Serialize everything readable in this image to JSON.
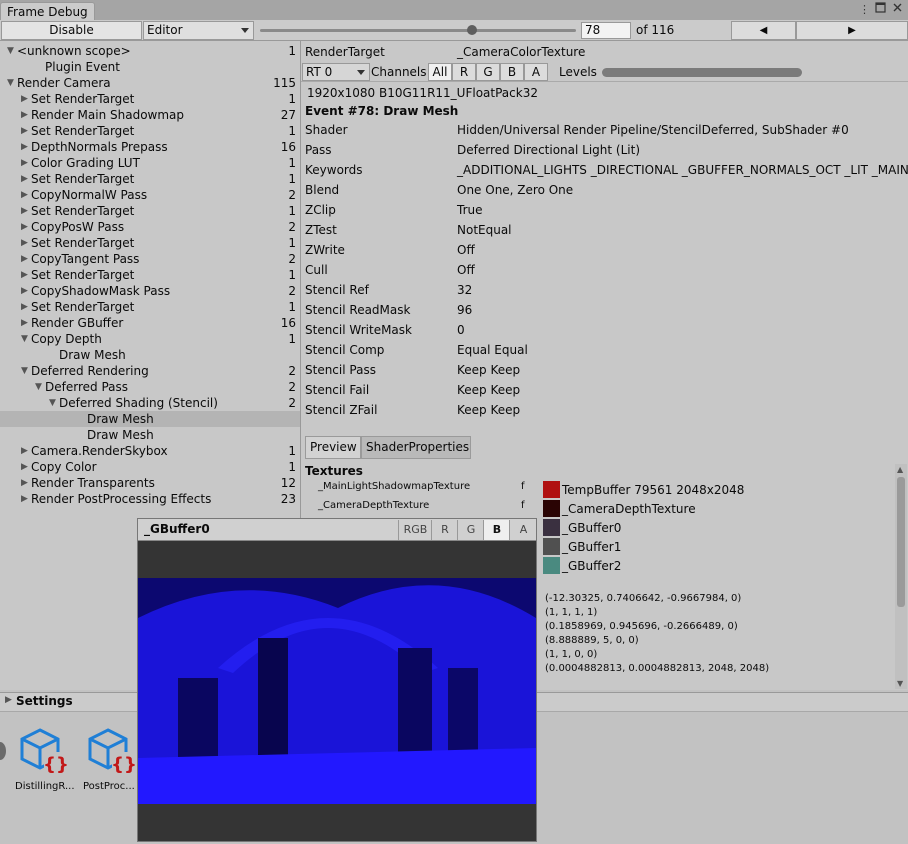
{
  "window": {
    "tab_title": "Frame Debug",
    "menu_icon": "kebab-menu-icon",
    "maximize_icon": "maximize-icon",
    "close_icon": "close-icon"
  },
  "toolbar": {
    "disable_label": "Disable",
    "target_select": "Editor",
    "frame_value": "78",
    "frame_of": "of 116",
    "prev_glyph": "◀",
    "next_glyph": "▶",
    "slider_fraction": 0.67
  },
  "tree": [
    {
      "label": "<unknown scope>",
      "count": "1",
      "indent": 0,
      "arrow": "▼"
    },
    {
      "label": "Plugin Event",
      "count": "",
      "indent": 2,
      "arrow": ""
    },
    {
      "label": "Render Camera",
      "count": "115",
      "indent": 0,
      "arrow": "▼"
    },
    {
      "label": "Set RenderTarget",
      "count": "1",
      "indent": 1,
      "arrow": "▶"
    },
    {
      "label": "Render Main Shadowmap",
      "count": "27",
      "indent": 1,
      "arrow": "▶"
    },
    {
      "label": "Set RenderTarget",
      "count": "1",
      "indent": 1,
      "arrow": "▶"
    },
    {
      "label": "DepthNormals Prepass",
      "count": "16",
      "indent": 1,
      "arrow": "▶"
    },
    {
      "label": "Color Grading LUT",
      "count": "1",
      "indent": 1,
      "arrow": "▶"
    },
    {
      "label": "Set RenderTarget",
      "count": "1",
      "indent": 1,
      "arrow": "▶"
    },
    {
      "label": "CopyNormalW Pass",
      "count": "2",
      "indent": 1,
      "arrow": "▶"
    },
    {
      "label": "Set RenderTarget",
      "count": "1",
      "indent": 1,
      "arrow": "▶"
    },
    {
      "label": "CopyPosW Pass",
      "count": "2",
      "indent": 1,
      "arrow": "▶"
    },
    {
      "label": "Set RenderTarget",
      "count": "1",
      "indent": 1,
      "arrow": "▶"
    },
    {
      "label": "CopyTangent Pass",
      "count": "2",
      "indent": 1,
      "arrow": "▶"
    },
    {
      "label": "Set RenderTarget",
      "count": "1",
      "indent": 1,
      "arrow": "▶"
    },
    {
      "label": "CopyShadowMask Pass",
      "count": "2",
      "indent": 1,
      "arrow": "▶"
    },
    {
      "label": "Set RenderTarget",
      "count": "1",
      "indent": 1,
      "arrow": "▶"
    },
    {
      "label": "Render GBuffer",
      "count": "16",
      "indent": 1,
      "arrow": "▶"
    },
    {
      "label": "Copy Depth",
      "count": "1",
      "indent": 1,
      "arrow": "▼"
    },
    {
      "label": "Draw Mesh",
      "count": "",
      "indent": 3,
      "arrow": ""
    },
    {
      "label": "Deferred Rendering",
      "count": "2",
      "indent": 1,
      "arrow": "▼"
    },
    {
      "label": "Deferred Pass",
      "count": "2",
      "indent": 2,
      "arrow": "▼"
    },
    {
      "label": "Deferred Shading (Stencil)",
      "count": "2",
      "indent": 3,
      "arrow": "▼"
    },
    {
      "label": "Draw Mesh",
      "count": "",
      "indent": 5,
      "arrow": "",
      "selected": true
    },
    {
      "label": "Draw Mesh",
      "count": "",
      "indent": 5,
      "arrow": ""
    },
    {
      "label": "Camera.RenderSkybox",
      "count": "1",
      "indent": 1,
      "arrow": "▶"
    },
    {
      "label": "Copy Color",
      "count": "1",
      "indent": 1,
      "arrow": "▶"
    },
    {
      "label": "Render Transparents",
      "count": "12",
      "indent": 1,
      "arrow": "▶"
    },
    {
      "label": "Render PostProcessing Effects",
      "count": "23",
      "indent": 1,
      "arrow": "▶"
    }
  ],
  "details": {
    "render_target_label": "RenderTarget",
    "render_target_value": "_CameraColorTexture",
    "rt_select": "RT 0",
    "channels_label": "Channels",
    "channels": [
      "All",
      "R",
      "G",
      "B",
      "A"
    ],
    "channels_active": "All",
    "levels_label": "Levels",
    "format": "1920x1080 B10G11R11_UFloatPack32",
    "event_title": "Event #78: Draw Mesh",
    "props": [
      {
        "k": "Shader",
        "v": "Hidden/Universal Render Pipeline/StencilDeferred, SubShader #0"
      },
      {
        "k": "Pass",
        "v": "Deferred Directional Light (Lit)"
      },
      {
        "k": "Keywords",
        "v": "_ADDITIONAL_LIGHTS _DIRECTIONAL _GBUFFER_NORMALS_OCT _LIT _MAIN_I"
      },
      {
        "k": "Blend",
        "v": "One One, Zero One"
      },
      {
        "k": "ZClip",
        "v": "True"
      },
      {
        "k": "ZTest",
        "v": "NotEqual"
      },
      {
        "k": "ZWrite",
        "v": "Off"
      },
      {
        "k": "Cull",
        "v": "Off"
      },
      {
        "k": "Stencil Ref",
        "v": "32"
      },
      {
        "k": "Stencil ReadMask",
        "v": "96"
      },
      {
        "k": "Stencil WriteMask",
        "v": "0"
      },
      {
        "k": "Stencil Comp",
        "v": "Equal Equal"
      },
      {
        "k": "Stencil Pass",
        "v": "Keep Keep"
      },
      {
        "k": "Stencil Fail",
        "v": "Keep Keep"
      },
      {
        "k": "Stencil ZFail",
        "v": "Keep Keep"
      }
    ],
    "tabs": [
      "Preview",
      "ShaderProperties"
    ],
    "tab_active": "ShaderProperties",
    "textures_header": "Textures",
    "textures": [
      {
        "name": "_MainLightShadowmapTexture",
        "flag": "f",
        "value": "TempBuffer 79561 2048x2048",
        "thumb_color": "#b01010"
      },
      {
        "name": "_CameraDepthTexture",
        "flag": "f",
        "value": "_CameraDepthTexture",
        "thumb_color": "#2a0404"
      },
      {
        "name": "",
        "flag": "",
        "value": "_GBuffer0",
        "thumb_color": "#3a3040"
      },
      {
        "name": "",
        "flag": "",
        "value": "_GBuffer1",
        "thumb_color": "#505050"
      },
      {
        "name": "",
        "flag": "",
        "value": "_GBuffer2",
        "thumb_color": "#4a8a80"
      }
    ],
    "vectors": [
      "(-12.30325, 0.7406642, -0.9667984, 0)",
      "(1, 1, 1, 1)",
      "(0.1858969, 0.945696, -0.2666489, 0)",
      "(8.888889, 5, 0, 0)",
      "(1, 1, 0, 0)",
      "(0.0004882813, 0.0004882813, 2048, 2048)"
    ]
  },
  "settings": {
    "label": "Settings",
    "assets": [
      {
        "label": "DistillingR...",
        "icon": "shader-asset-icon"
      },
      {
        "label": "PostProc...",
        "icon": "shader-asset-icon"
      }
    ]
  },
  "popup": {
    "title": "_GBuffer0",
    "channels": [
      "RGB",
      "R",
      "G",
      "B",
      "A"
    ],
    "channels_active": "B",
    "preview_color": "#1a14d8"
  }
}
